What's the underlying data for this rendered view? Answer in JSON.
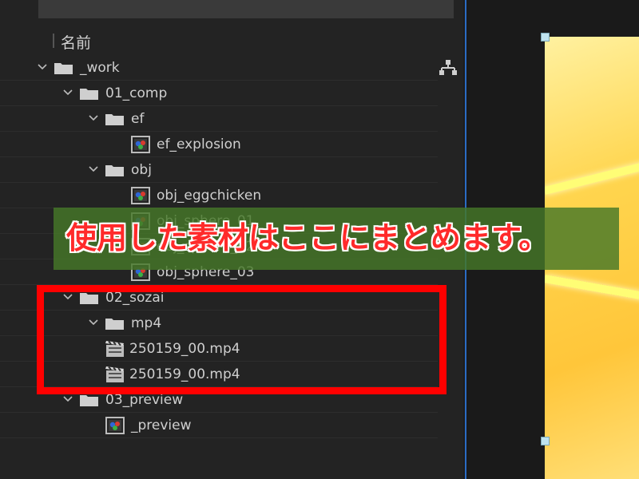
{
  "project_panel": {
    "header": {
      "name_column": "名前"
    },
    "tree": [
      {
        "label": "_work",
        "type": "folder",
        "expanded": true
      },
      {
        "label": "01_comp",
        "type": "folder",
        "expanded": true
      },
      {
        "label": "ef",
        "type": "folder",
        "expanded": true
      },
      {
        "label": "ef_explosion",
        "type": "composition"
      },
      {
        "label": "obj",
        "type": "folder",
        "expanded": true
      },
      {
        "label": "obj_eggchicken",
        "type": "composition"
      },
      {
        "label": "obj_sphere_01",
        "type": "composition"
      },
      {
        "label": "obj_sphere_02",
        "type": "composition"
      },
      {
        "label": "obj_sphere_03",
        "type": "composition"
      },
      {
        "label": "02_sozai",
        "type": "folder",
        "expanded": true
      },
      {
        "label": "mp4",
        "type": "folder",
        "expanded": true
      },
      {
        "label": "250159_00.mp4",
        "type": "footage"
      },
      {
        "label": "250159_00.mp4",
        "type": "footage"
      },
      {
        "label": "03_preview",
        "type": "folder",
        "expanded": true
      },
      {
        "label": "_preview",
        "type": "composition"
      }
    ]
  },
  "annotation": {
    "text": "使用した素材はここにまとめます。",
    "highlight_color": "#ff0000",
    "banner_color": "#467828"
  },
  "colors": {
    "panel_bg": "#232323",
    "accent_border": "#2b6cc4",
    "viewer_image": "#ffc63a"
  }
}
